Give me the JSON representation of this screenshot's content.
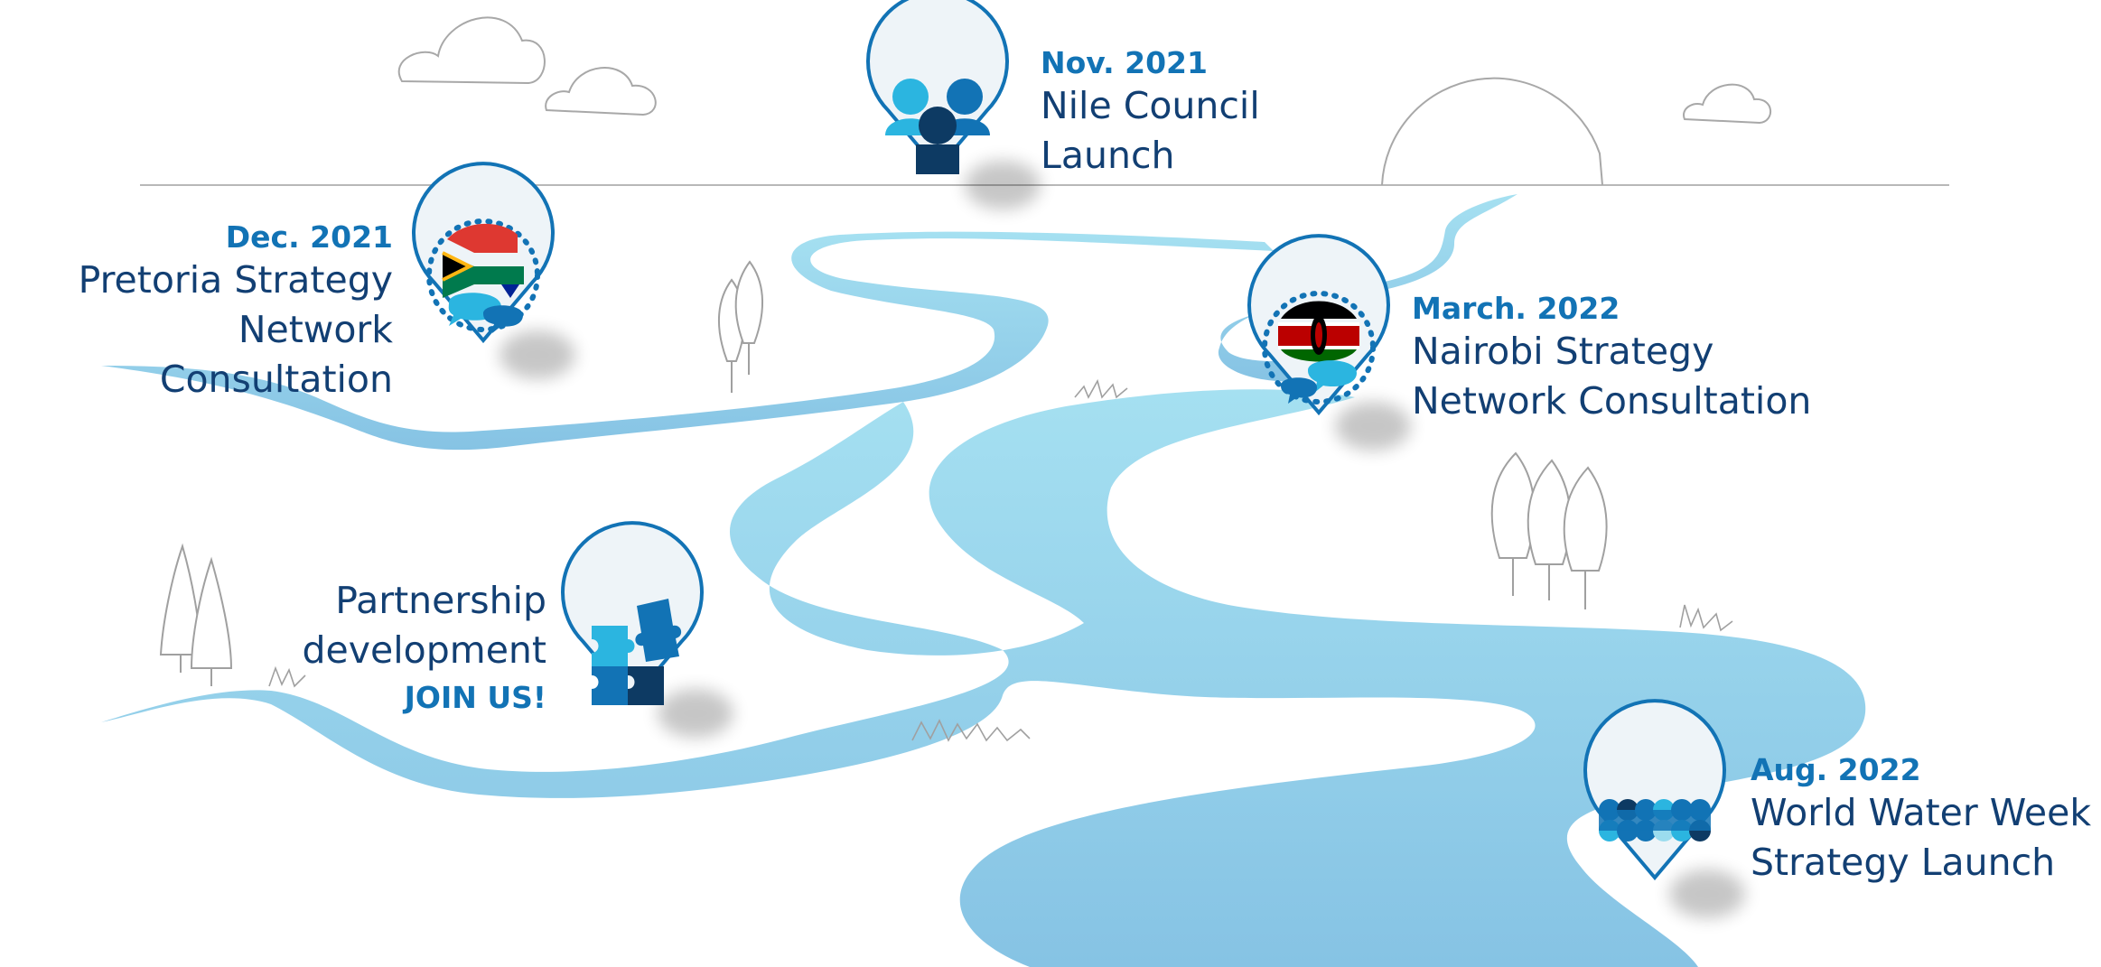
{
  "colors": {
    "river": "#9bdcee",
    "river_deep": "#8cc9e6",
    "pin_outline": "#1273b5",
    "pin_fill": "#eef4f8",
    "text_dark": "#123f73",
    "text_accent": "#1273b5",
    "sketch_line": "#9a9a9a"
  },
  "milestones": [
    {
      "id": "nile",
      "date": "Nov. 2021",
      "lines": [
        "Nile Council",
        "Launch"
      ],
      "icon": "people-group-icon"
    },
    {
      "id": "pretoria",
      "date": "Dec. 2021",
      "lines": [
        "Pretoria Strategy",
        "Network Consultation"
      ],
      "icon": "south-africa-flag-chat-icon"
    },
    {
      "id": "nairobi",
      "date": "March. 2022",
      "lines": [
        "Nairobi Strategy",
        "Network Consultation"
      ],
      "icon": "kenya-flag-chat-icon"
    },
    {
      "id": "partnership",
      "date": "",
      "lines": [
        "Partnership",
        "development"
      ],
      "cta": "JOIN US!",
      "icon": "puzzle-pieces-icon"
    },
    {
      "id": "wwweek",
      "date": "Aug. 2022",
      "lines": [
        "World Water Week",
        "Strategy Launch"
      ],
      "icon": "waves-logo-icon"
    }
  ]
}
